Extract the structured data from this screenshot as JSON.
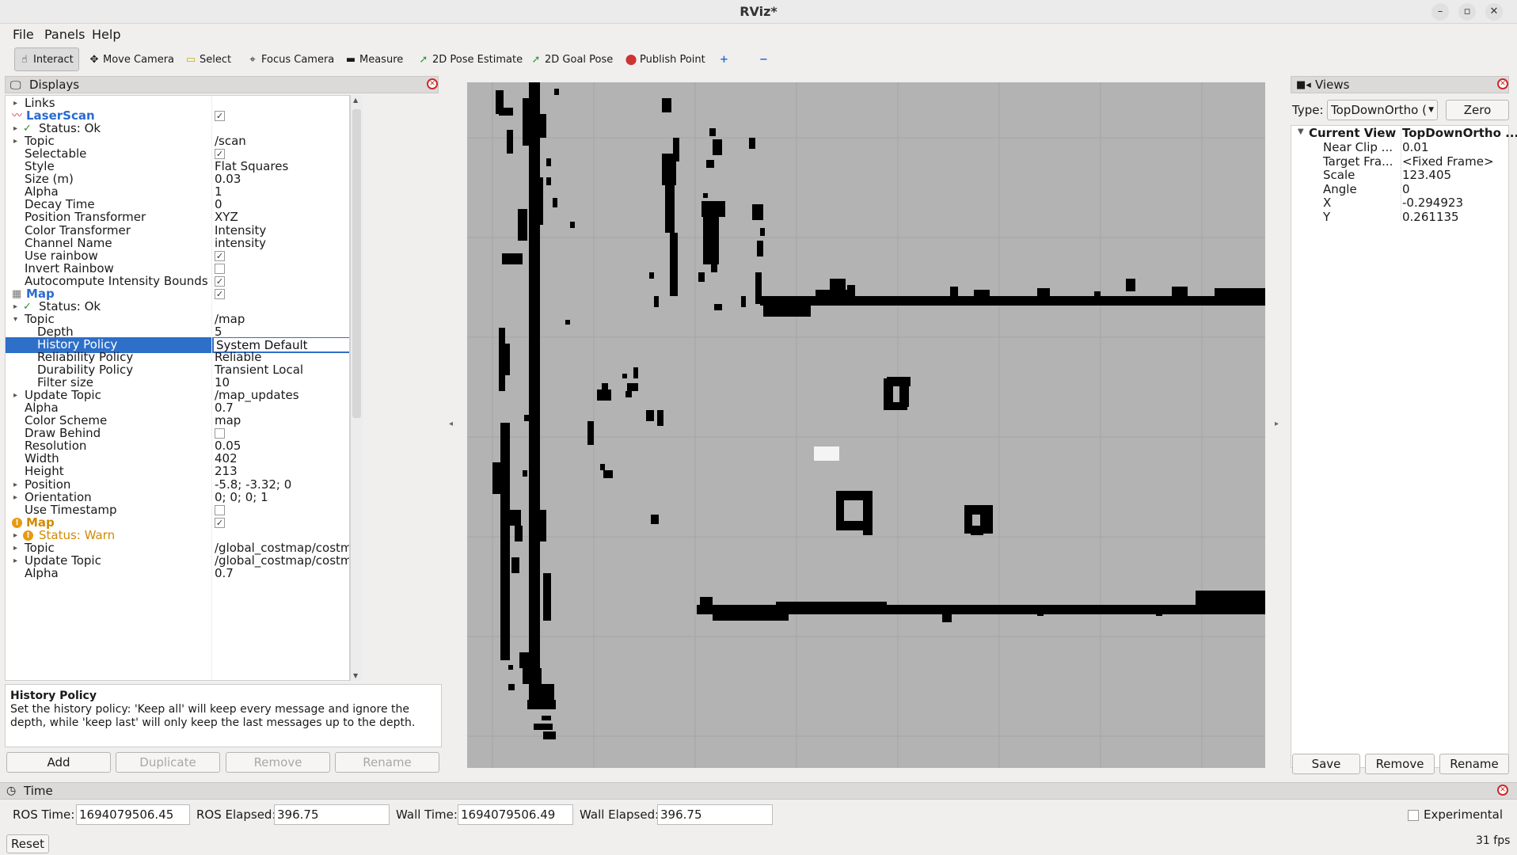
{
  "window": {
    "title": "RViz*"
  },
  "menu": {
    "file": "File",
    "panels": "Panels",
    "help": "Help"
  },
  "toolbar": {
    "interact": "Interact",
    "move_camera": "Move Camera",
    "select": "Select",
    "focus_camera": "Focus Camera",
    "measure": "Measure",
    "pose_estimate": "2D Pose Estimate",
    "goal_pose": "2D Goal Pose",
    "publish_point": "Publish Point",
    "add_tool": "+",
    "remove_tool": "−"
  },
  "displays": {
    "title": "Displays",
    "rows": [
      {
        "label": "Links",
        "value": ""
      },
      {
        "label": "LaserScan",
        "value": "✓"
      },
      {
        "label": "Status: Ok",
        "value": ""
      },
      {
        "label": "Topic",
        "value": "/scan"
      },
      {
        "label": "Selectable",
        "value": "✓"
      },
      {
        "label": "Style",
        "value": "Flat Squares"
      },
      {
        "label": "Size (m)",
        "value": "0.03"
      },
      {
        "label": "Alpha",
        "value": "1"
      },
      {
        "label": "Decay Time",
        "value": "0"
      },
      {
        "label": "Position Transformer",
        "value": "XYZ"
      },
      {
        "label": "Color Transformer",
        "value": "Intensity"
      },
      {
        "label": "Channel Name",
        "value": "intensity"
      },
      {
        "label": "Use rainbow",
        "value": "✓"
      },
      {
        "label": "Invert Rainbow",
        "value": ""
      },
      {
        "label": "Autocompute Intensity Bounds",
        "value": "✓"
      },
      {
        "label": "Map",
        "value": "✓"
      },
      {
        "label": "Status: Ok",
        "value": ""
      },
      {
        "label": "Topic",
        "value": "/map"
      },
      {
        "label": "Depth",
        "value": "5"
      },
      {
        "label": "History Policy",
        "value": "System Default"
      },
      {
        "label": "Reliability Policy",
        "value": "Reliable"
      },
      {
        "label": "Durability Policy",
        "value": "Transient Local"
      },
      {
        "label": "Filter size",
        "value": "10"
      },
      {
        "label": "Update Topic",
        "value": "/map_updates"
      },
      {
        "label": "Alpha",
        "value": "0.7"
      },
      {
        "label": "Color Scheme",
        "value": "map"
      },
      {
        "label": "Draw Behind",
        "value": ""
      },
      {
        "label": "Resolution",
        "value": "0.05"
      },
      {
        "label": "Width",
        "value": "402"
      },
      {
        "label": "Height",
        "value": "213"
      },
      {
        "label": "Position",
        "value": "-5.8; -3.32; 0"
      },
      {
        "label": "Orientation",
        "value": "0; 0; 0; 1"
      },
      {
        "label": "Use Timestamp",
        "value": ""
      },
      {
        "label": "Map",
        "value": "✓"
      },
      {
        "label": "Status: Warn",
        "value": ""
      },
      {
        "label": "Topic",
        "value": "/global_costmap/costmap"
      },
      {
        "label": "Update Topic",
        "value": "/global_costmap/costmap_updates"
      },
      {
        "label": "Alpha",
        "value": "0.7"
      }
    ]
  },
  "description": {
    "heading": "History Policy",
    "text": "Set the history policy: 'Keep all' will keep every message and ignore the depth, while 'keep last' will only keep the last messages up to the depth."
  },
  "display_buttons": {
    "add": "Add",
    "duplicate": "Duplicate",
    "remove": "Remove",
    "rename": "Rename"
  },
  "views": {
    "title": "Views",
    "type_label": "Type:",
    "type_value": "TopDownOrtho (",
    "zero": "Zero",
    "current_view": "Current View",
    "current_view_value": "TopDownOrtho ...",
    "props": [
      {
        "label": "Near Clip ...",
        "value": "0.01"
      },
      {
        "label": "Target Fra...",
        "value": "<Fixed Frame>"
      },
      {
        "label": "Scale",
        "value": "123.405"
      },
      {
        "label": "Angle",
        "value": "0"
      },
      {
        "label": "X",
        "value": "-0.294923"
      },
      {
        "label": "Y",
        "value": "0.261135"
      }
    ],
    "save": "Save",
    "remove": "Remove",
    "rename": "Rename"
  },
  "time": {
    "title": "Time",
    "ros_time_label": "ROS Time:",
    "ros_time": "1694079506.45",
    "ros_elapsed_label": "ROS Elapsed:",
    "ros_elapsed": "396.75",
    "wall_time_label": "Wall Time:",
    "wall_time": "1694079506.49",
    "wall_elapsed_label": "Wall Elapsed:",
    "wall_elapsed": "396.75",
    "experimental": "Experimental",
    "reset": "Reset",
    "fps": "31 fps"
  },
  "colors": {
    "accent": "#2e6fc8",
    "map_free": "#b3b3b3",
    "map_occupied": "#000000",
    "warn": "#d18a00"
  }
}
